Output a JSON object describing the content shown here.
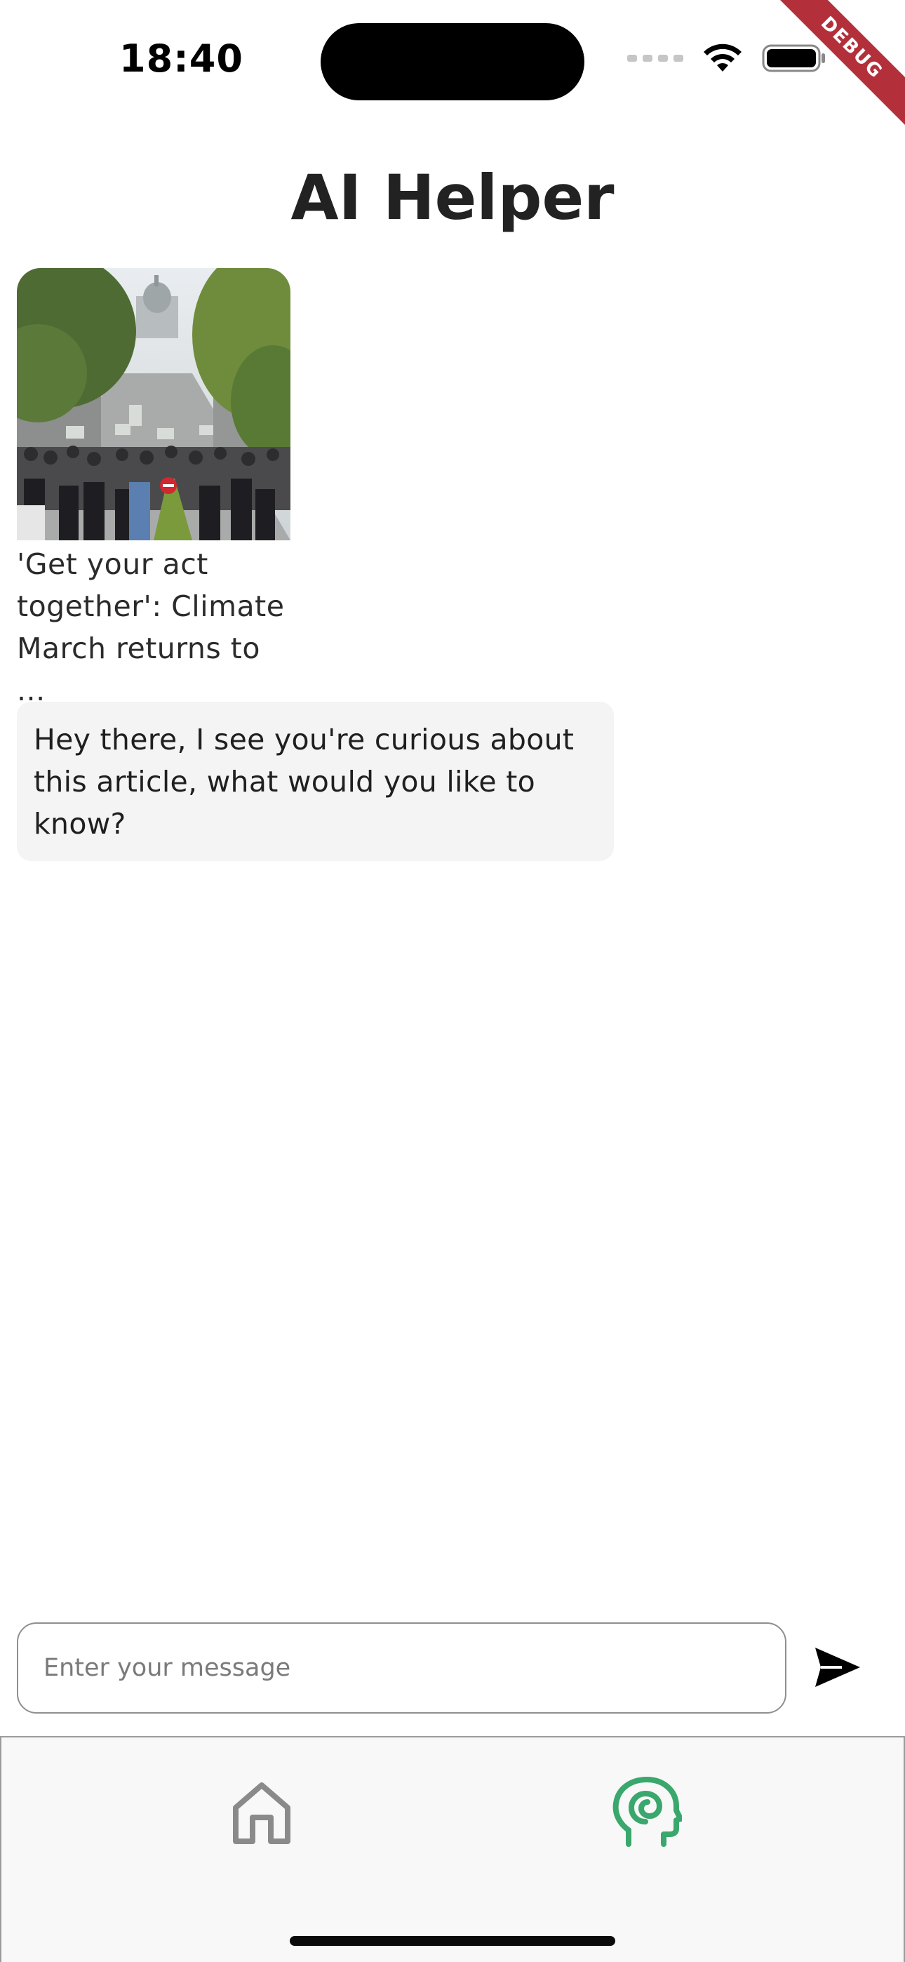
{
  "status_bar": {
    "time": "18:40",
    "icons": [
      "signal-icon",
      "wifi-icon",
      "battery-icon"
    ]
  },
  "debug_banner": "DEBUG",
  "header": {
    "title": "AI Helper"
  },
  "article": {
    "caption": "'Get your act together': Climate March returns to ...",
    "image": "climate-march-street-photo"
  },
  "chat": {
    "messages": [
      {
        "role": "assistant",
        "text": "Hey there, I see you're curious about this article, what would you like to know?"
      }
    ]
  },
  "composer": {
    "placeholder": "Enter your message",
    "value": "",
    "send_icon": "send-icon"
  },
  "bottom_nav": {
    "items": [
      {
        "icon": "home-icon",
        "active": false
      },
      {
        "icon": "ai-head-icon",
        "active": true
      }
    ],
    "active_color": "#3aa76d",
    "inactive_color": "#8a8a8a"
  }
}
